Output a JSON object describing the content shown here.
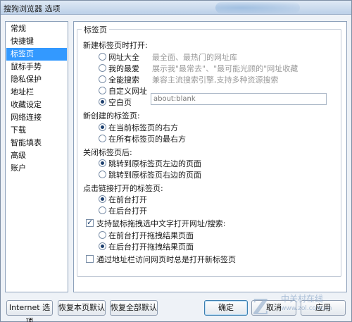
{
  "window": {
    "title": "搜狗浏览器 选项"
  },
  "sidebar": {
    "items": [
      {
        "label": "常规"
      },
      {
        "label": "快捷键"
      },
      {
        "label": "标签页"
      },
      {
        "label": "鼠标手势"
      },
      {
        "label": "隐私保护"
      },
      {
        "label": "地址栏"
      },
      {
        "label": "收藏设定"
      },
      {
        "label": "网络连接"
      },
      {
        "label": "下载"
      },
      {
        "label": "智能填表"
      },
      {
        "label": "高级"
      },
      {
        "label": "账户"
      }
    ],
    "selected": "标签页"
  },
  "panel": {
    "group_title": "标签页",
    "new_window": {
      "heading": "新建标签页时打开:",
      "options": [
        {
          "label": "网址大全",
          "desc": "最全面、最热门的网址库"
        },
        {
          "label": "我的最爱",
          "desc": "展示我\"最常去\"、\"最可能光顾的\"网址收藏"
        },
        {
          "label": "全能搜索",
          "desc": "兼容主流搜索引擎,支持多种资源搜索"
        },
        {
          "label": "自定义网址",
          "desc": ""
        },
        {
          "label": "空白页",
          "desc": ""
        }
      ],
      "selected": "空白页",
      "custom_url_placeholder": "about:blank"
    },
    "new_tab_position": {
      "heading": "新创建的标签页:",
      "options": [
        "在当前标签页的右方",
        "在所有标签页的最右方"
      ],
      "selected": "在当前标签页的右方"
    },
    "after_close": {
      "heading": "关闭标签页后:",
      "options": [
        "跳转到原标签页左边的页面",
        "跳转到原标签页右边的页面"
      ],
      "selected": "跳转到原标签页左边的页面"
    },
    "link_open": {
      "heading": "点击链接打开的标签页:",
      "options": [
        "在前台打开",
        "在后台打开"
      ],
      "selected": "在前台打开"
    },
    "drag_search": {
      "label": "支持鼠标拖拽选中文字打开网址/搜索:",
      "checked": true,
      "options": [
        "在前台打开拖拽结果页面",
        "在后台打开拖拽结果页面"
      ],
      "selected": "在后台打开拖拽结果页面"
    },
    "address_bar_new_tab": {
      "label": "通过地址栏访问网页时总是打开新标签页",
      "checked": false
    }
  },
  "buttons": {
    "internet_options": "Internet 选项",
    "restore_page": "恢复本页默认",
    "restore_all": "恢复全部默认",
    "ok": "确定",
    "cancel": "取消",
    "apply": "应用"
  },
  "watermark": {
    "cn": "中关村在线",
    "en": "www.zol.com.cn",
    "logo": "Z"
  }
}
